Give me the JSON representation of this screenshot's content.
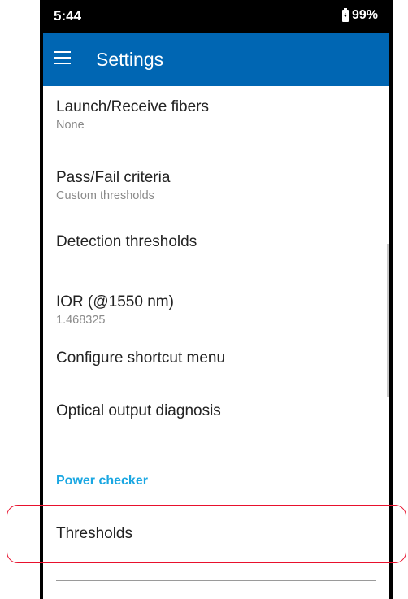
{
  "status_bar": {
    "time": "5:44",
    "battery": "99%"
  },
  "app_bar": {
    "title": "Settings",
    "menu_icon": "hamburger-menu-icon"
  },
  "settings": {
    "launch_receive": {
      "title": "Launch/Receive fibers",
      "value": "None"
    },
    "pass_fail": {
      "title": "Pass/Fail criteria",
      "value": "Custom thresholds"
    },
    "detection_thresholds": {
      "title": "Detection thresholds"
    },
    "ior": {
      "title": "IOR (@1550 nm)",
      "value": "1.468325"
    },
    "shortcut_menu": {
      "title": "Configure shortcut menu"
    },
    "optical_output": {
      "title": "Optical output diagnosis"
    },
    "power_checker_header": "Power checker",
    "thresholds": {
      "title": "Thresholds"
    }
  },
  "colors": {
    "app_bar": "#0066b3",
    "section_header": "#1aa7e2",
    "highlight": "#e8112d"
  }
}
